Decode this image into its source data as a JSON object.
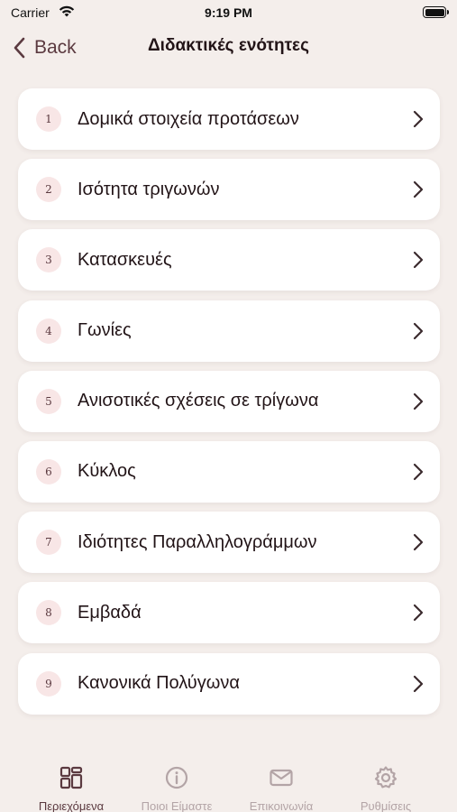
{
  "status_bar": {
    "carrier": "Carrier",
    "time": "9:19 PM"
  },
  "nav": {
    "back_label": "Back",
    "title": "Διδακτικές ενότητες"
  },
  "list": {
    "items": [
      {
        "number": "1",
        "label": "Δομικά στοιχεία προτάσεων"
      },
      {
        "number": "2",
        "label": "Ισότητα τριγωνών"
      },
      {
        "number": "3",
        "label": "Κατασκευές"
      },
      {
        "number": "4",
        "label": "Γωνίες"
      },
      {
        "number": "5",
        "label": "Ανισοτικές σχέσεις σε τρίγωνα"
      },
      {
        "number": "6",
        "label": "Κύκλος"
      },
      {
        "number": "7",
        "label": "Ιδιότητες Παραλληλογράμμων"
      },
      {
        "number": "8",
        "label": "Εμβαδά"
      },
      {
        "number": "9",
        "label": "Κανονικά Πολύγωνα"
      }
    ]
  },
  "tabs": [
    {
      "label": "Περιεχόμενα",
      "icon": "grid-icon",
      "active": true
    },
    {
      "label": "Ποιοι Είμαστε",
      "icon": "info-icon",
      "active": false
    },
    {
      "label": "Επικοινωνία",
      "icon": "mail-icon",
      "active": false
    },
    {
      "label": "Ρυθμίσεις",
      "icon": "gear-icon",
      "active": false
    }
  ],
  "colors": {
    "background": "#f4eeeb",
    "accent": "#5b3a40",
    "badge_bg": "#f8e6e6",
    "inactive": "#b3a4a6"
  }
}
